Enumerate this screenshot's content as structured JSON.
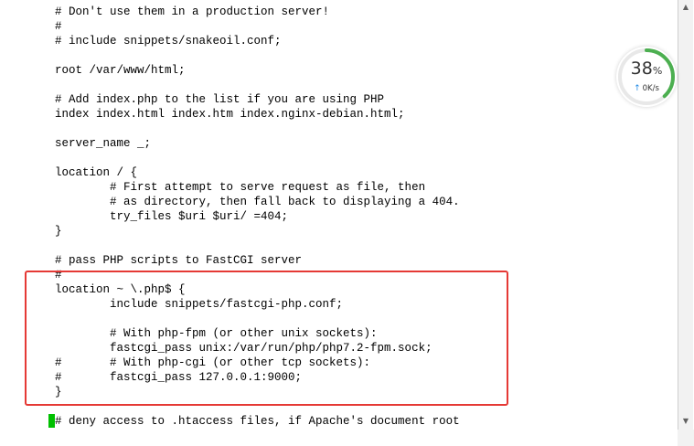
{
  "editor": {
    "lines": [
      {
        "text": "# Don't use them in a production server!"
      },
      {
        "text": "#"
      },
      {
        "text": "# include snippets/snakeoil.conf;"
      },
      {
        "text": ""
      },
      {
        "text": "root /var/www/html;"
      },
      {
        "text": ""
      },
      {
        "text": "# Add index.php to the list if you are using PHP"
      },
      {
        "text": "index index.html index.htm index.nginx-debian.html;"
      },
      {
        "text": ""
      },
      {
        "text": "server_name _;"
      },
      {
        "text": ""
      },
      {
        "text": "location / {"
      },
      {
        "text": "        # First attempt to serve request as file, then"
      },
      {
        "text": "        # as directory, then fall back to displaying a 404."
      },
      {
        "text": "        try_files $uri $uri/ =404;"
      },
      {
        "text": "}"
      },
      {
        "text": ""
      },
      {
        "text": "# pass PHP scripts to FastCGI server"
      },
      {
        "text": "#"
      },
      {
        "text": "location ~ \\.php$ {"
      },
      {
        "text": "        include snippets/fastcgi-php.conf;"
      },
      {
        "text": ""
      },
      {
        "text": "        # With php-fpm (or other unix sockets):"
      },
      {
        "text": "        fastcgi_pass unix:/var/run/php/php7.2-fpm.sock;"
      },
      {
        "text": "#       # With php-cgi (or other tcp sockets):"
      },
      {
        "text": "#       fastcgi_pass 127.0.0.1:9000;"
      },
      {
        "text": "}"
      },
      {
        "text": ""
      },
      {
        "text": "# deny access to .htaccess files, if Apache's document root"
      }
    ],
    "highlight_color": "#e53935",
    "cursor_color": "#00c000"
  },
  "monitor": {
    "percent": "38",
    "percent_value": 0.38,
    "unit": "%",
    "speed": "0K/s",
    "ring_color": "#4caf50",
    "arrow_color": "#1e88e5"
  },
  "scrollbar": {
    "up_icon": "triangle-up-icon",
    "down_icon": "triangle-down-icon"
  }
}
